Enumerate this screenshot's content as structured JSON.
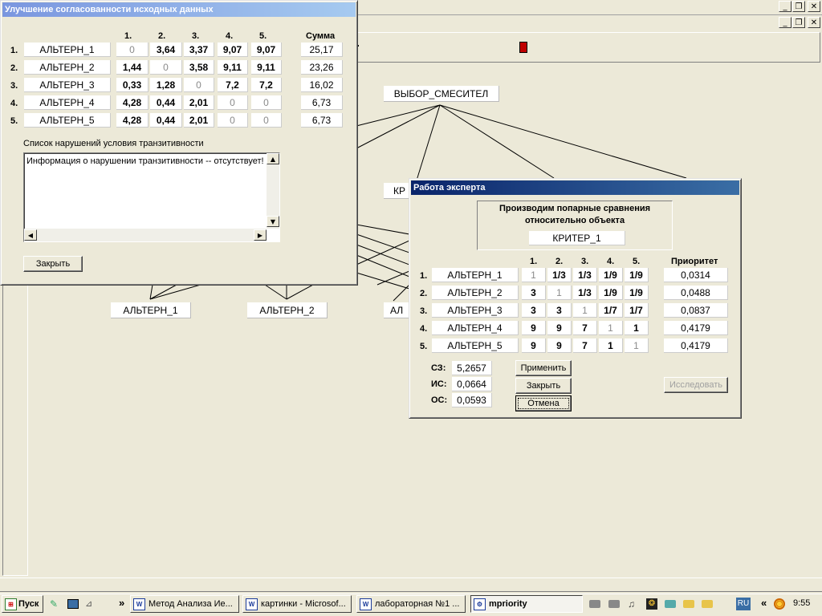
{
  "main_app": {
    "toolbar_icon": "book-icon",
    "main_node": "ВЫБОР_СМЕСИТЕЛ",
    "nodes": [
      "КР",
      "АЛЬТЕРН_1",
      "АЛЬТЕРН_2",
      "АЛ"
    ]
  },
  "consistency_window": {
    "title": "Улучшение согласованности исходных данных",
    "col_headers": [
      "1.",
      "2.",
      "3.",
      "4.",
      "5."
    ],
    "sum_header": "Сумма",
    "rows": [
      {
        "num": "1.",
        "name": "АЛЬТЕРН_1",
        "values": [
          "0",
          "3,64",
          "3,37",
          "9,07",
          "9,07"
        ],
        "sum": "25,17"
      },
      {
        "num": "2.",
        "name": "АЛЬТЕРН_2",
        "values": [
          "1,44",
          "0",
          "3,58",
          "9,11",
          "9,11"
        ],
        "sum": "23,26"
      },
      {
        "num": "3.",
        "name": "АЛЬТЕРН_3",
        "values": [
          "0,33",
          "1,28",
          "0",
          "7,2",
          "7,2"
        ],
        "sum": "16,02"
      },
      {
        "num": "4.",
        "name": "АЛЬТЕРН_4",
        "values": [
          "4,28",
          "0,44",
          "2,01",
          "0",
          "0"
        ],
        "sum": "6,73"
      },
      {
        "num": "5.",
        "name": "АЛЬТЕРН_5",
        "values": [
          "4,28",
          "0,44",
          "2,01",
          "0",
          "0"
        ],
        "sum": "6,73"
      }
    ],
    "violations_label": "Список нарушений условия транзитивности",
    "violations_text": "Информация о нарушении транзитивности -- отсутствует!",
    "close_button": "Закрыть"
  },
  "expert_window": {
    "title": "Работа эксперта",
    "group_label_line1": "Производим попарные сравнения",
    "group_label_line2": "относительно объекта",
    "object": "КРИТЕР_1",
    "col_headers": [
      "1.",
      "2.",
      "3.",
      "4.",
      "5."
    ],
    "priority_header": "Приоритет",
    "rows": [
      {
        "num": "1.",
        "name": "АЛЬТЕРН_1",
        "values": [
          "1",
          "1/3",
          "1/3",
          "1/9",
          "1/9"
        ],
        "priority": "0,0314"
      },
      {
        "num": "2.",
        "name": "АЛЬТЕРН_2",
        "values": [
          "3",
          "1",
          "1/3",
          "1/9",
          "1/9"
        ],
        "priority": "0,0488"
      },
      {
        "num": "3.",
        "name": "АЛЬТЕРН_3",
        "values": [
          "3",
          "3",
          "1",
          "1/7",
          "1/7"
        ],
        "priority": "0,0837"
      },
      {
        "num": "4.",
        "name": "АЛЬТЕРН_4",
        "values": [
          "9",
          "9",
          "7",
          "1",
          "1"
        ],
        "priority": "0,4179"
      },
      {
        "num": "5.",
        "name": "АЛЬТЕРН_5",
        "values": [
          "9",
          "9",
          "7",
          "1",
          "1"
        ],
        "priority": "0,4179"
      }
    ],
    "stats": [
      {
        "label": "СЗ:",
        "value": "5,2657"
      },
      {
        "label": "ИС:",
        "value": "0,0664"
      },
      {
        "label": "ОС:",
        "value": "0,0593"
      }
    ],
    "apply_button": "Применить",
    "close_button": "Закрыть",
    "cancel_button": "Отмена",
    "investigate_button": "Исследовать"
  },
  "taskbar": {
    "start": "Пуск",
    "chevron": "»",
    "tasks": [
      {
        "label": "Метод Анализа Ие...",
        "icon": "word-icon"
      },
      {
        "label": "картинки - Microsof...",
        "icon": "word-icon"
      },
      {
        "label": "лабораторная №1 ...",
        "icon": "word-icon"
      },
      {
        "label": "mpriority",
        "icon": "app-icon"
      }
    ],
    "lang": "RU",
    "tray_chevron": "«",
    "time": "9:55"
  }
}
